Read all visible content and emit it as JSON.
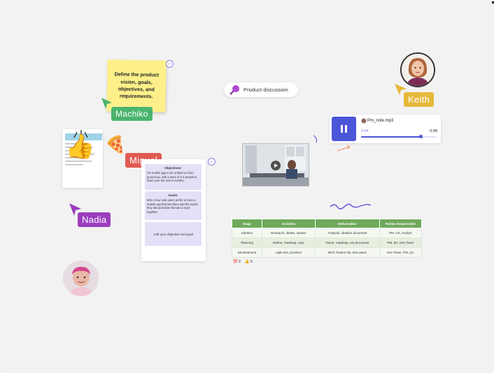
{
  "sticky_note": {
    "text": "Define the product vision, goals, objectives, and requirements."
  },
  "cursors": {
    "machiko": {
      "name": "Machiko",
      "color": "#4bb46e"
    },
    "miguel": {
      "name": "Miguel",
      "color": "#e05a52"
    },
    "nadia": {
      "name": "Nadia",
      "color": "#9b3dbf"
    },
    "keith": {
      "name": "Keith",
      "color": "#e6b83b"
    }
  },
  "emojis": {
    "thumbs_up": "👍",
    "pizza": "🍕"
  },
  "objectives_board": {
    "objectives_heading": "Objectives:",
    "objectives_text": "OS mobile app to be worked on from ground-up, with a team of 3-4 people to build, over the next 6 months.",
    "goals_heading": "Goals:",
    "goals_text": "60% of our web users prefer to have a mobile app that lets them add the books they like and invite friends to read together",
    "placeholder": "Add your objective and goal"
  },
  "discussion_pill": {
    "label": "Product discussion",
    "icon": "push-pin-icon"
  },
  "audio_player": {
    "filename": "Pm_note.mp3",
    "current_time": "0:04",
    "total_time": "0:08",
    "progress": 0.79
  },
  "stage_table": {
    "headers": [
      "Stage",
      "Activities",
      "Deliverables",
      "Parties Responsible"
    ],
    "rows": [
      [
        "Ideation",
        "Research, ideate, assess",
        "Analysis, ideation document",
        "PM, UX, Analyst"
      ],
      [
        "Planning",
        "Define, roadmap, reqs",
        "Vision, roadmap, req document",
        "PM, BA, Dev Team"
      ],
      [
        "Development",
        "Agile dev, prioritize",
        "MVP, feature list, test cases",
        "Dev Team, PM, QA"
      ]
    ]
  },
  "reactions": [
    {
      "emoji": "💯",
      "count": "2"
    },
    {
      "emoji": "👍",
      "count": "5"
    }
  ]
}
